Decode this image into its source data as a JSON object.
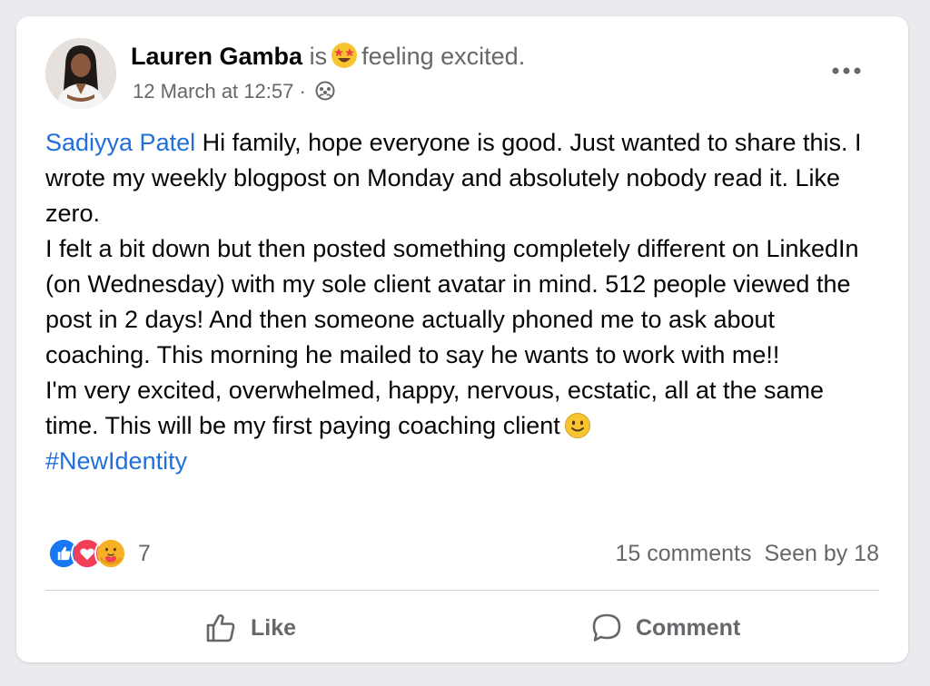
{
  "post": {
    "author": "Lauren Gamba",
    "is_text": "is",
    "feeling_text": "feeling excited.",
    "timestamp": "12 March at 12:57",
    "separator": "·",
    "audience_icon": "group-audience-icon",
    "mention": "Sadiyya Patel",
    "paragraphs": [
      " Hi family, hope everyone is good. Just wanted to share this. I wrote my weekly blogpost on Monday and absolutely nobody read it. Like zero.",
      "I felt a bit down but then posted something completely different on LinkedIn (on Wednesday) with my sole client avatar in mind. 512 people viewed the post in 2 days! And then someone actually phoned me to ask about coaching. This morning he mailed to say he wants to work with me!!",
      "I'm very excited, overwhelmed, happy, nervous, ecstatic, all at the same time. This will be my first paying coaching client"
    ],
    "hashtag": "#NewIdentity"
  },
  "reactions": {
    "icons": [
      "like-reaction-icon",
      "love-reaction-icon",
      "care-reaction-icon"
    ],
    "count": "7"
  },
  "stats": {
    "comments": "15 comments",
    "seen": "Seen by 18"
  },
  "actions": {
    "like_label": "Like",
    "comment_label": "Comment"
  },
  "colors": {
    "link": "#216fdb",
    "muted": "#65676b",
    "like_blue": "#1877f2",
    "love_red": "#f33e58",
    "care_yellow": "#f7b125"
  }
}
